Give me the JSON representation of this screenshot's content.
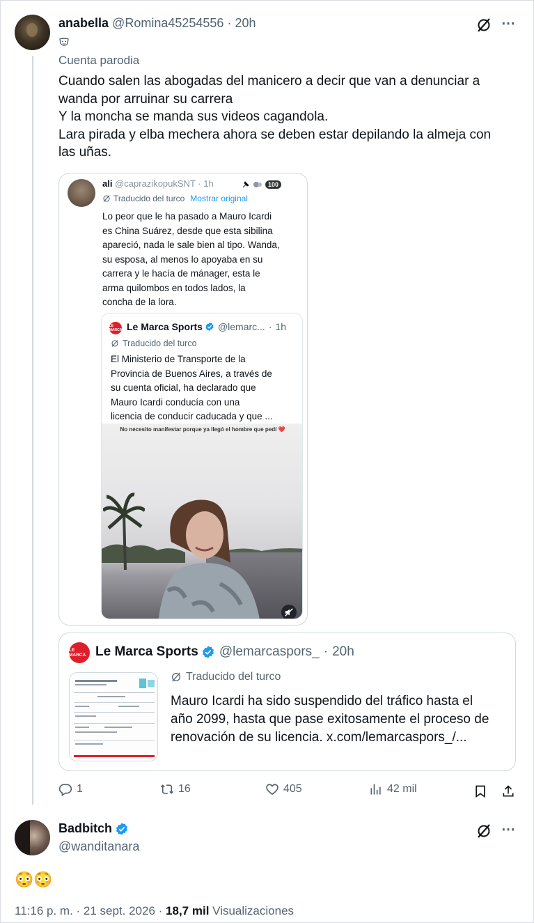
{
  "post1": {
    "name": "anabella",
    "handle": "@Romina45254556",
    "separator": "·",
    "time": "20h",
    "parody_label": "Cuenta parodia",
    "text_lines": [
      "Cuando salen las abogadas del manicero a decir que van a denunciar a",
      "wanda por arruinar su carrera",
      "Y la moncha se manda sus videos cagandola.",
      "Lara pirada y elba mechera ahora se deben estar depilando la almeja con",
      "las uñas."
    ],
    "quote": {
      "name": "ali",
      "handle": "@caprazikopukSNT",
      "time": "1h",
      "badge": "100",
      "translated_label": "Traducido del turco",
      "show_original": "Mostrar original",
      "text_lines": [
        "Lo peor que le ha pasado a Mauro Icardi",
        "es China Suárez, desde que esta sibilina",
        "apareció, nada le sale bien al tipo. Wanda,",
        "su esposa, al menos lo apoyaba en su",
        "carrera y le hacía de mánager, esta le",
        "arma quilombos en todos lados, la",
        "concha de la lora."
      ],
      "inner": {
        "logo_text": "LE MARCA",
        "name": "Le Marca Sports",
        "handle": "@lemarc...",
        "time": "1h",
        "translated_label": "Traducido del turco",
        "text_lines": [
          "El Ministerio de Transporte de la",
          "Provincia de Buenos Aires, a través de",
          "su cuenta oficial, ha declarado que",
          "Mauro Icardi conducía con una",
          "licencia de conducir caducada y que ..."
        ],
        "video_caption": "No necesito manifestar porque ya llegó el hombre que pedí ❤️"
      }
    },
    "quote2": {
      "logo_text": "LE MARCA",
      "name": "Le Marca Sports",
      "handle": "@lemarcaspors_",
      "time": "20h",
      "translated_label": "Traducido del turco",
      "text_lines": [
        "Mauro Icardi ha sido suspendido del tráfico hasta el",
        "año 2099, hasta que pase exitosamente el proceso de",
        "renovación de su licencia. x.com/lemarcaspors_/..."
      ]
    },
    "actions": {
      "replies": "1",
      "reposts": "16",
      "likes": "405",
      "views": "42 mil"
    }
  },
  "post2": {
    "name": "Badbitch",
    "handle": "@wanditanara",
    "text": "😳😳",
    "meta_time": "11:16 p. m. · 21 sept. 2026 · ",
    "meta_views_count": "18,7 mil",
    "meta_views_label": "Visualizaciones"
  },
  "colors": {
    "text": "#0f1419",
    "secondary": "#536471",
    "border": "#cfd9de",
    "verified": "#1d9bf0",
    "brand_red": "#e01e2a"
  }
}
